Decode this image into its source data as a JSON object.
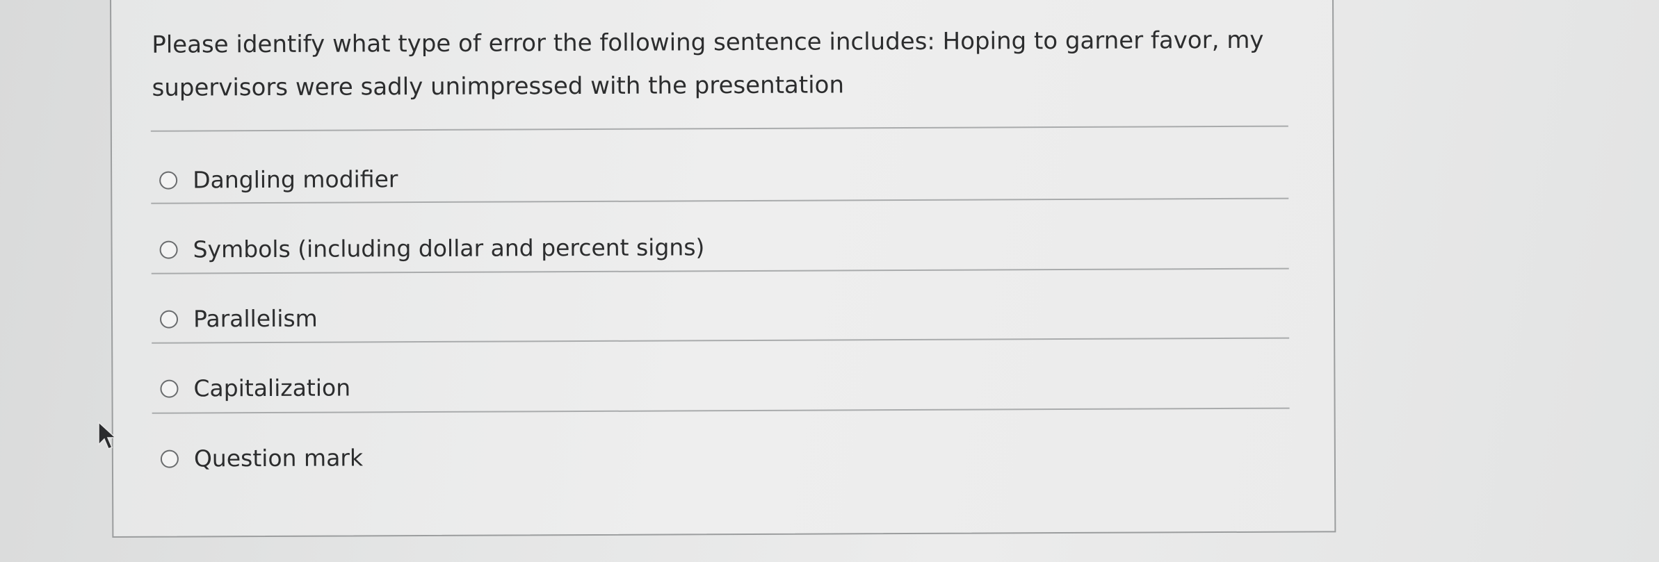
{
  "question": {
    "text": "Please identify what type of error the following sentence includes: Hoping to garner favor, my supervisors were sadly unimpressed with the presentation"
  },
  "options": [
    {
      "label": "Dangling modifier",
      "selected": false
    },
    {
      "label": "Symbols (including dollar and percent signs)",
      "selected": false
    },
    {
      "label": "Parallelism",
      "selected": false
    },
    {
      "label": "Capitalization",
      "selected": false
    },
    {
      "label": "Question mark",
      "selected": false
    }
  ],
  "cursor": {
    "icon": "mouse-pointer-icon"
  }
}
